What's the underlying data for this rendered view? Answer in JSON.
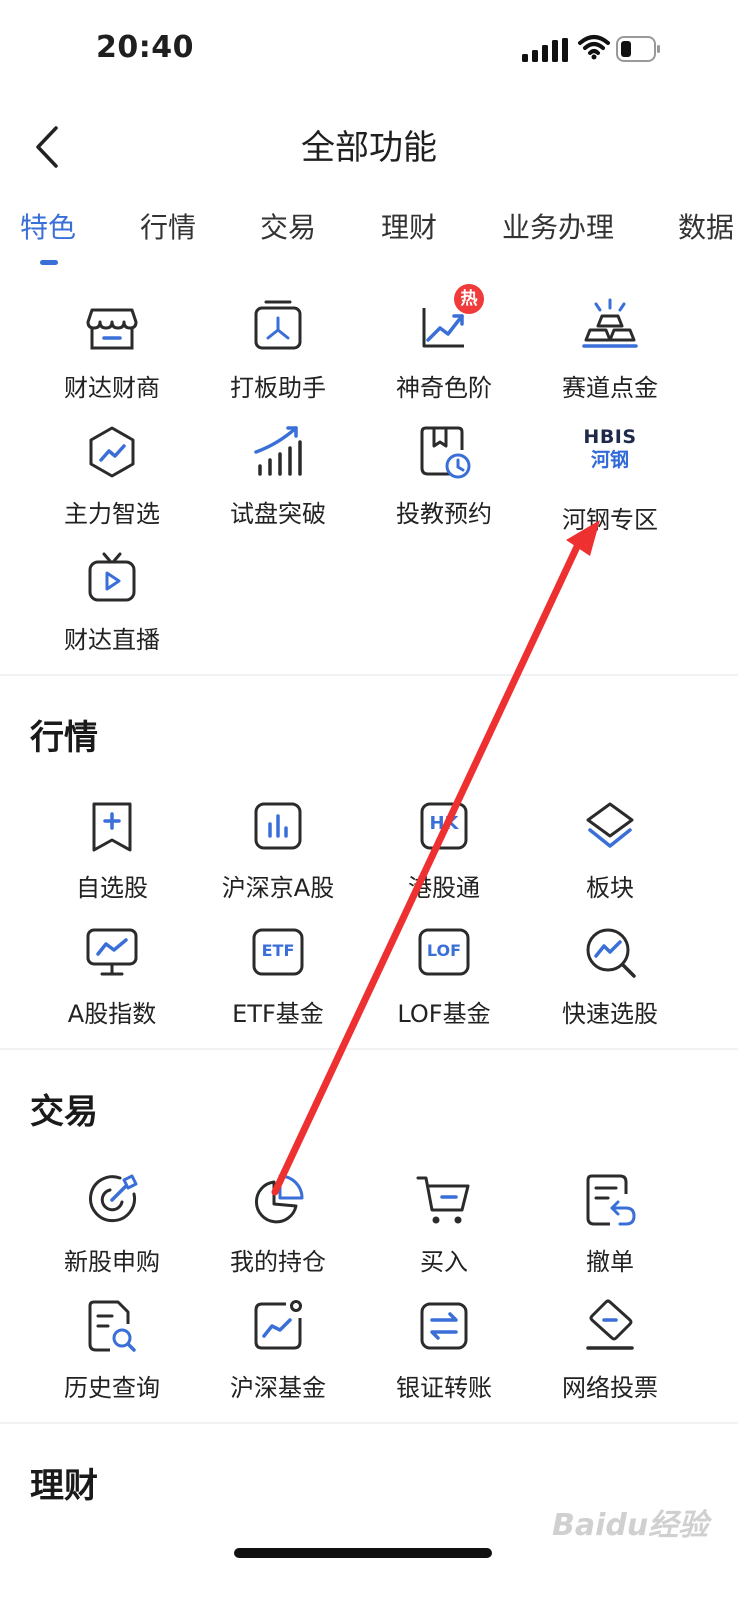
{
  "status_bar": {
    "time": "20:40"
  },
  "header": {
    "title": "全部功能"
  },
  "tabs": [
    {
      "label": "特色",
      "active": true
    },
    {
      "label": "行情"
    },
    {
      "label": "交易"
    },
    {
      "label": "理财"
    },
    {
      "label": "业务办理"
    },
    {
      "label": "数据"
    }
  ],
  "featured": {
    "items": [
      {
        "label": "财达财商",
        "icon": "store-icon"
      },
      {
        "label": "打板助手",
        "icon": "board-helper-icon"
      },
      {
        "label": "神奇色阶",
        "icon": "trend-chart-icon",
        "badge": "热"
      },
      {
        "label": "赛道点金",
        "icon": "gold-bar-icon"
      },
      {
        "label": "主力智选",
        "icon": "hexagon-trend-icon"
      },
      {
        "label": "试盘突破",
        "icon": "bar-growth-icon"
      },
      {
        "label": "投教预约",
        "icon": "book-clock-icon"
      },
      {
        "label": "河钢专区",
        "icon": "hbis-logo-icon",
        "logo_text": "HBIS",
        "logo_sub": "河钢"
      },
      {
        "label": "财达直播",
        "icon": "tv-play-icon"
      }
    ]
  },
  "market": {
    "title": "行情",
    "items": [
      {
        "label": "自选股",
        "icon": "bookmark-plus-icon"
      },
      {
        "label": "沪深京A股",
        "icon": "bar-chart-icon"
      },
      {
        "label": "港股通",
        "icon": "hk-icon",
        "icon_text": "HK"
      },
      {
        "label": "板块",
        "icon": "layers-icon"
      },
      {
        "label": "A股指数",
        "icon": "monitor-chart-icon"
      },
      {
        "label": "ETF基金",
        "icon": "etf-icon",
        "icon_text": "ETF"
      },
      {
        "label": "LOF基金",
        "icon": "lof-icon",
        "icon_text": "LOF"
      },
      {
        "label": "快速选股",
        "icon": "magnify-trend-icon"
      }
    ]
  },
  "trade": {
    "title": "交易",
    "items": [
      {
        "label": "新股申购",
        "icon": "ipo-target-icon"
      },
      {
        "label": "我的持仓",
        "icon": "pie-chart-icon"
      },
      {
        "label": "买入",
        "icon": "cart-icon"
      },
      {
        "label": "撤单",
        "icon": "document-undo-icon"
      },
      {
        "label": "历史查询",
        "icon": "document-search-icon"
      },
      {
        "label": "沪深基金",
        "icon": "fund-chart-icon"
      },
      {
        "label": "银证转账",
        "icon": "transfer-icon"
      },
      {
        "label": "网络投票",
        "icon": "vote-tag-icon"
      }
    ]
  },
  "finance": {
    "title": "理财"
  },
  "watermark": {
    "text": "Baidu经验"
  },
  "colors": {
    "accent": "#3a6fd8",
    "icon_dark": "#2b2b2b",
    "badge": "#f03b3b",
    "arrow": "#ee3030"
  }
}
